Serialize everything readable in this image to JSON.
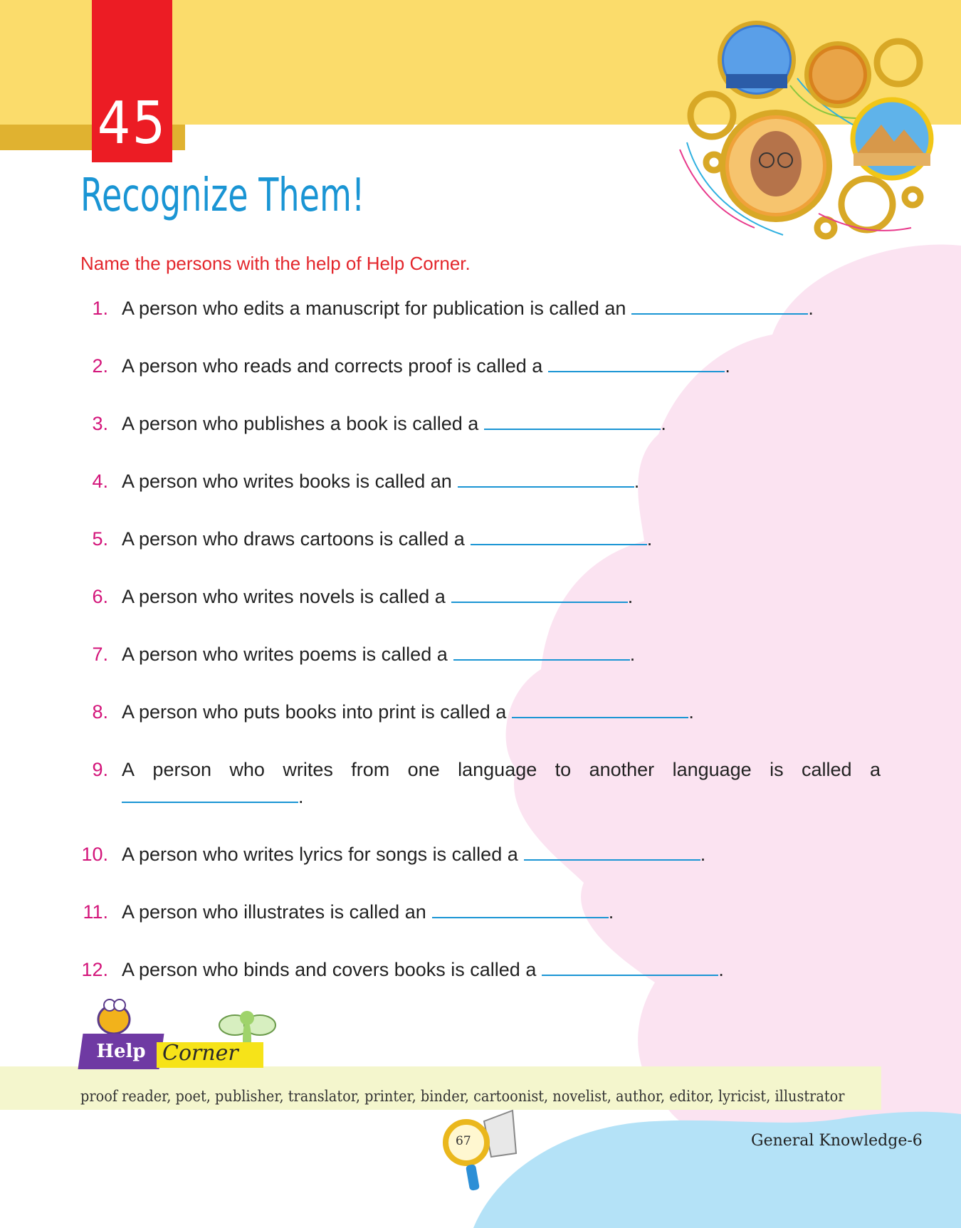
{
  "header": {
    "activity_number": "45",
    "title": "Recognize Them!",
    "instruction": "Name the persons with the help of Help Corner."
  },
  "questions": [
    {
      "num": "1.",
      "text": "A person who edits a manuscript for publication is called an"
    },
    {
      "num": "2.",
      "text": "A person who reads and corrects proof is called a"
    },
    {
      "num": "3.",
      "text": "A person who publishes a book is called a"
    },
    {
      "num": "4.",
      "text": "A person who writes books is called an"
    },
    {
      "num": "5.",
      "text": "A person who draws cartoons is called a"
    },
    {
      "num": "6.",
      "text": "A person who writes novels is called a"
    },
    {
      "num": "7.",
      "text": "A person who writes poems is called a"
    },
    {
      "num": "8.",
      "text": "A person who puts books into print is called a"
    },
    {
      "num": "9.",
      "text": "A person who writes from one language to another language is called a"
    },
    {
      "num": "10.",
      "text": "A person who writes lyrics for songs is called a"
    },
    {
      "num": "11.",
      "text": "A person who illustrates is called an"
    },
    {
      "num": "12.",
      "text": "A person who binds and covers books is called a"
    }
  ],
  "help_corner": {
    "label_help": "Help",
    "label_corner": "Corner",
    "words": "proof reader, poet, publisher, translator, printer, binder, cartoonist, novelist, author, editor, lyricist, illustrator"
  },
  "footer": {
    "page_number": "67",
    "book_title": "General Knowledge-6"
  },
  "colors": {
    "yellow_band": "#fbdc6b",
    "red_tab": "#ec1c24",
    "title_blue": "#1a95d4",
    "instruction_red": "#e3262c",
    "number_magenta": "#d3157a",
    "pink_blob": "#fbe3f1",
    "blue_blob": "#b4e2f7"
  }
}
